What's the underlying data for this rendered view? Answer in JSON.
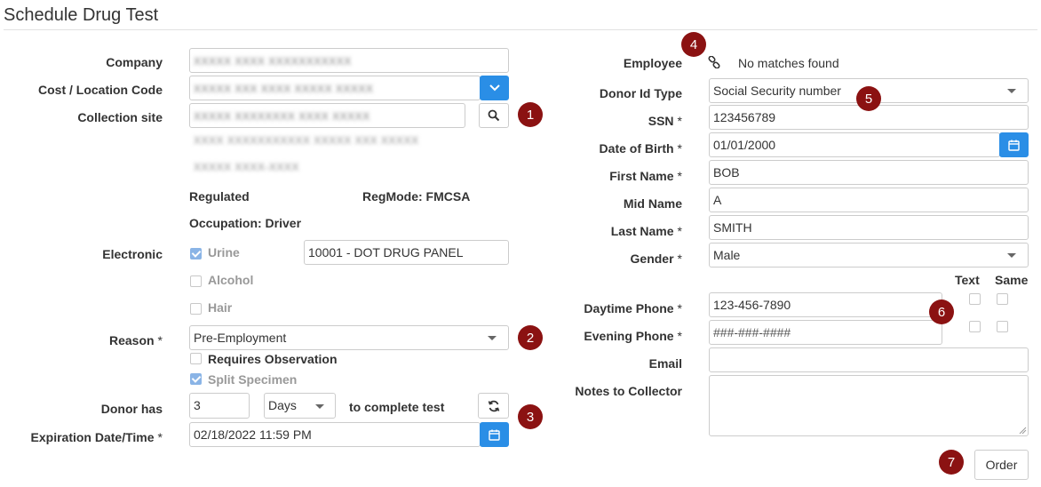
{
  "page": {
    "title": "Schedule Drug Test"
  },
  "left": {
    "company": {
      "label": "Company",
      "value": "XXXXX XXXX XXXXXXXXXXX"
    },
    "cost_location": {
      "label": "Cost / Location Code",
      "value": "XXXXX XXX XXXX XXXXX XXXXX"
    },
    "collection_site": {
      "label": "Collection site",
      "value": "XXXXX XXXXXXXX XXXX XXXXX",
      "address_line": "XXXX XXXXXXXXXXX XXXXX XXX XXXXX",
      "phone_line": "XXXXX XXXX-XXXX"
    },
    "regulated": "Regulated",
    "regmode": "RegMode: FMCSA",
    "occupation": "Occupation: Driver",
    "electronic": {
      "label": "Electronic",
      "urine": "Urine",
      "urine_checked": true,
      "alcohol": "Alcohol",
      "hair": "Hair",
      "panel": "10001 - DOT DRUG PANEL"
    },
    "reason": {
      "label": "Reason",
      "required": "*",
      "value": "Pre-Employment"
    },
    "requires_observation": "Requires Observation",
    "split_specimen": "Split Specimen",
    "donor_has": {
      "label": "Donor has",
      "value": "3",
      "unit": "Days",
      "suffix": "to complete test"
    },
    "expiration": {
      "label": "Expiration Date/Time",
      "required": "*",
      "value": "02/18/2022 11:59 PM"
    }
  },
  "right": {
    "employee": {
      "label": "Employee",
      "status": "No matches found"
    },
    "donor_id_type": {
      "label": "Donor Id Type",
      "value": "Social Security number"
    },
    "ssn": {
      "label": "SSN",
      "required": "*",
      "value": "123456789"
    },
    "dob": {
      "label": "Date of Birth",
      "required": "*",
      "value": "01/01/2000"
    },
    "first_name": {
      "label": "First Name",
      "required": "*",
      "value": "BOB"
    },
    "mid_name": {
      "label": "Mid Name",
      "value": "A"
    },
    "last_name": {
      "label": "Last Name",
      "required": "*",
      "value": "SMITH"
    },
    "gender": {
      "label": "Gender",
      "required": "*",
      "value": "Male"
    },
    "phone_cols": {
      "text": "Text",
      "same": "Same"
    },
    "daytime_phone": {
      "label": "Daytime Phone",
      "required": "*",
      "value": "123-456-7890"
    },
    "evening_phone": {
      "label": "Evening Phone",
      "required": "*",
      "placeholder": "###-###-####"
    },
    "email": {
      "label": "Email",
      "value": ""
    },
    "notes": {
      "label": "Notes to Collector",
      "value": ""
    },
    "order_button": "Order"
  },
  "badges": [
    "1",
    "2",
    "3",
    "4",
    "5",
    "6",
    "7"
  ],
  "colors": {
    "accent": "#2a8ee6",
    "badge": "#8b1212",
    "checked": "#8ab4e6"
  },
  "icons": {
    "search": "search-icon",
    "dropdown": "chevron-down-icon",
    "calendar": "calendar-icon",
    "refresh": "refresh-icon",
    "link": "link-icon"
  }
}
